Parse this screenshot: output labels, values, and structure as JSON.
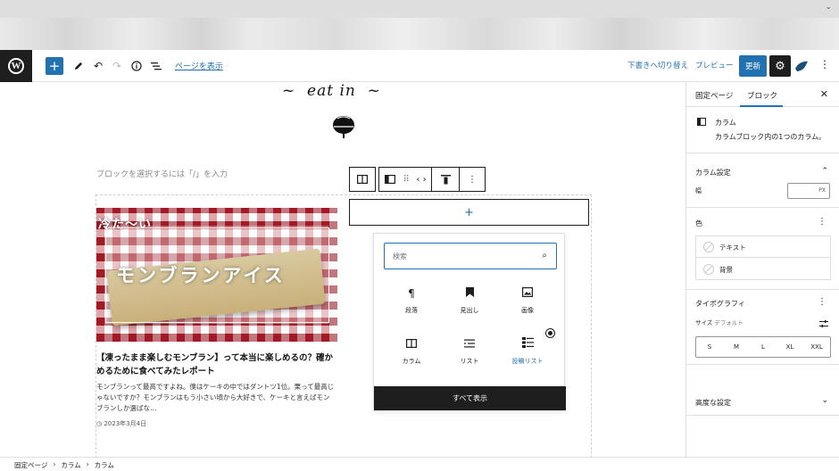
{
  "header": {
    "view_page": "ページを表示",
    "switch_draft": "下書きへ切り替え",
    "preview": "プレビュー",
    "update": "更新",
    "icons": [
      "wordpress-logo",
      "plus-icon",
      "pencil-icon",
      "undo-icon",
      "redo-icon",
      "info-icon",
      "list-view-icon",
      "gear-icon",
      "jetpack-icon",
      "more-vertical-icon"
    ]
  },
  "canvas": {
    "site_logo_text": "~  eat in  ~",
    "placeholder": "ブロックを選択するには「/」を入力",
    "post": {
      "thumb_small_text": "冷た～い",
      "thumb_title": "モンブランアイス",
      "title": "【凍ったまま楽しむモンブラン】って本当に楽しめるの？確かめるために食べてみたレポート",
      "excerpt": "モンブランって最高ですよね。僕はケーキの中ではダントツ1位。栗って最高じゃないですか？モンブランはもう小さい頃から大好きで、ケーキと言えばモンブランしか選ばな…",
      "date": "2023年3月4日"
    }
  },
  "inserter": {
    "search_placeholder": "検索",
    "blocks": [
      {
        "label": "段落",
        "icon": "paragraph-icon"
      },
      {
        "label": "見出し",
        "icon": "heading-icon"
      },
      {
        "label": "画像",
        "icon": "image-icon"
      },
      {
        "label": "カラム",
        "icon": "columns-icon"
      },
      {
        "label": "リスト",
        "icon": "list-icon"
      },
      {
        "label": "投稿リスト",
        "icon": "post-list-icon"
      }
    ],
    "browse_all": "すべて表示"
  },
  "sidebar": {
    "tab_page": "固定ページ",
    "tab_block": "ブロック",
    "block_name": "カラム",
    "block_desc": "カラムブロック内の1つのカラム。",
    "column_settings": "カラム設定",
    "width_label": "幅",
    "width_unit": "PX",
    "color": "色",
    "color_text": "テキスト",
    "color_bg": "背景",
    "typography": "タイポグラフィ",
    "size_label": "サイズ",
    "size_default": "デフォルト",
    "sizes": [
      "S",
      "M",
      "L",
      "XL",
      "XXL"
    ],
    "advanced": "高度な設定"
  },
  "footer": {
    "crumbs": [
      "固定ページ",
      "カラム",
      "カラム"
    ]
  }
}
